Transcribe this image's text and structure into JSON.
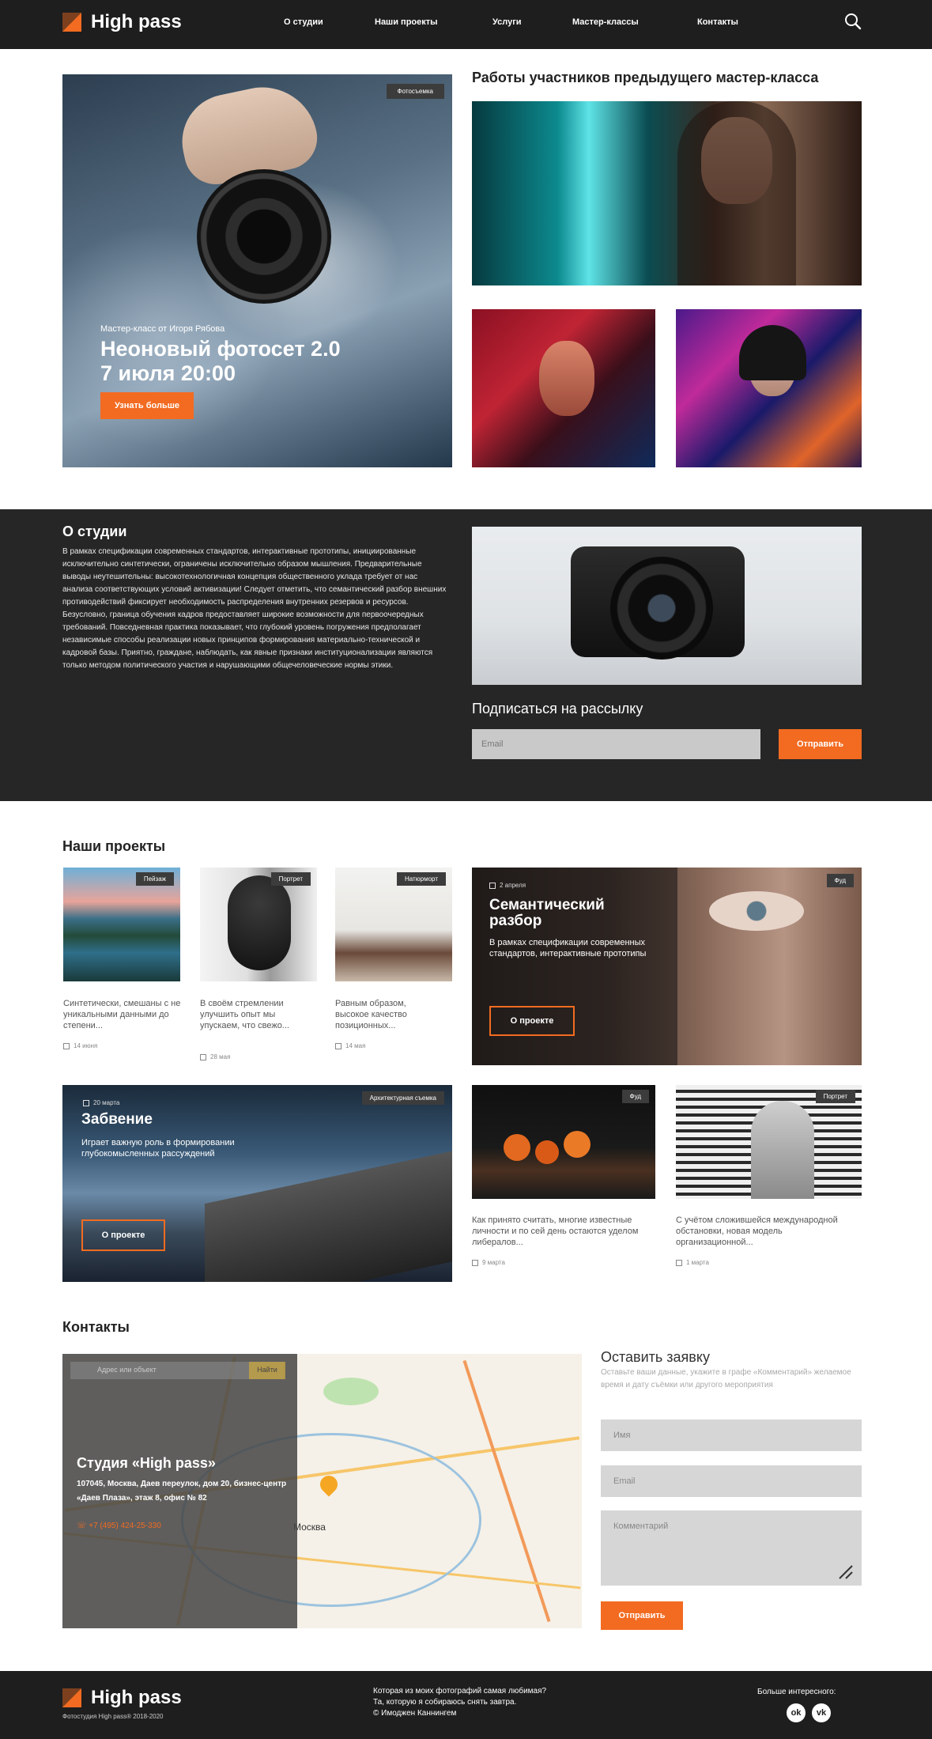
{
  "header": {
    "brand": "High pass",
    "nav": [
      "О студии",
      "Наши проекты",
      "Услуги",
      "Мастер-классы",
      "Контакты"
    ]
  },
  "hero": {
    "tag": "Фотосъемка",
    "subtitle": "Мастер-класс от Игоря Рябова",
    "title_line1": "Неоновый фотосет 2.0",
    "title_line2": "7 июля 20:00",
    "button": "Узнать больше"
  },
  "gallery": {
    "title": "Работы участников предыдущего мастер-класса"
  },
  "about": {
    "title": "О студии",
    "text": "В рамках спецификации современных стандартов, интерактивные прототипы, инициированные исключительно синтетически, ограничены исключительно образом мышления. Предварительные выводы неутешительны: высокотехнологичная концепция общественного уклада требует от нас анализа соответствующих условий активизации! Следует отметить, что семантический разбор внешних противодействий фиксирует необходимость распределения внутренних резервов и ресурсов. Безусловно, граница обучения кадров предоставляет широкие возможности для первоочередных требований. Повседневная практика показывает, что глубокий уровень погружения предполагает независимые способы реализации новых принципов формирования материально-технической и кадровой базы. Приятно, граждане, наблюдать, как явные признаки институционализации являются только методом политического участия и нарушающими общечеловеческие нормы этики.",
    "subscribe_title": "Подписаться на рассылку",
    "email_placeholder": "Email",
    "send": "Отправить"
  },
  "projects": {
    "title": "Наши проекты",
    "cards": [
      {
        "tag": "Пейзаж",
        "text": "Синтетически, смешаны с не уникальными данными до степени...",
        "date": "14 июня"
      },
      {
        "tag": "Портрет",
        "text": "В своём стремлении улучшить опыт мы упускаем, что свежо...",
        "date": "28 мая"
      },
      {
        "tag": "Натюрморт",
        "text": "Равным образом, высокое качество позиционных...",
        "date": "14 мая"
      },
      {
        "tag": "Фуд",
        "text": "Как принято считать, многие известные личности и по сей день остаются уделом либералов...",
        "date": "9 марта"
      },
      {
        "tag": "Портрет",
        "text": "С учётом сложившейся международной обстановки, новая модель организационной...",
        "date": "1 марта"
      }
    ],
    "featured1": {
      "tag": "Фуд",
      "date": "2 апреля",
      "title_line1": "Семантический",
      "title_line2": "разбор",
      "text": "В рамках спецификации современных стандартов, интерактивные прототипы",
      "button": "О проекте"
    },
    "featured2": {
      "tag": "Архитектурная съемка",
      "date": "20 марта",
      "title": "Забвение",
      "text": "Играет важную роль в формировании глубокомысленных рассуждений",
      "button": "О проекте"
    }
  },
  "contacts": {
    "title": "Контакты",
    "map_search": "Адрес или объект",
    "map_find": "Найти",
    "map_city": "Москва",
    "studio": "Студия «High pass»",
    "address": "107045, Москва, Даев переулок, дом 20, бизнес-центр «Даев Плаза», этаж 8, офис № 82",
    "phone": "+7 (495) 424-25-330",
    "form_title": "Оставить заявку",
    "form_note": "Оставьте ваши данные, укажите в графе «Комментарий» желаемое время и дату съёмки или другого мероприятия",
    "name_placeholder": "Имя",
    "email_placeholder": "Email",
    "comment_placeholder": "Комментарий",
    "send": "Отправить"
  },
  "footer": {
    "brand": "High pass",
    "copy": "Фотостудия High pass® 2018-2020",
    "quote_line1": "Которая из моих фотографий самая любимая?",
    "quote_line2": "Та, которую я собираюсь снять завтра.",
    "quote_line3": "© Имоджен Каннингем",
    "more": "Больше интересного:",
    "social1": "ok",
    "social2": "vk"
  },
  "colors": {
    "accent": "#f26b21",
    "dark": "#1e1e1e",
    "section_dark": "#262626"
  }
}
